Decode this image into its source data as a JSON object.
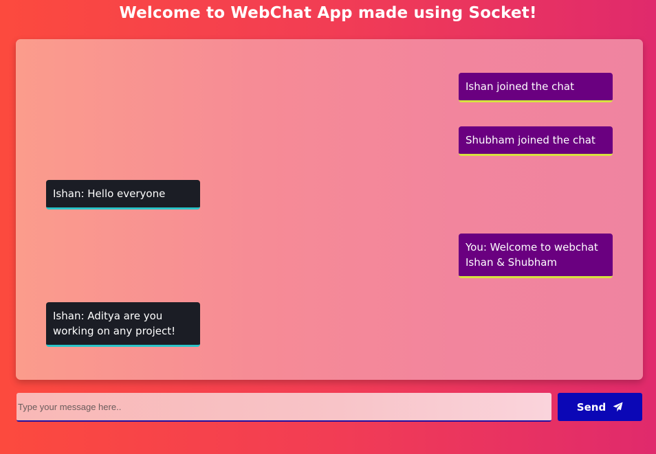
{
  "header": {
    "title": "Welcome to WebChat App made using Socket!"
  },
  "messages": [
    {
      "text": "Ishan joined the chat",
      "type": "outgoing"
    },
    {
      "text": "Shubham joined the chat",
      "type": "outgoing"
    },
    {
      "text": "Ishan: Hello everyone",
      "type": "incoming"
    },
    {
      "text": "You: Welcome to webchat Ishan & Shubham",
      "type": "outgoing"
    },
    {
      "text": "Ishan: Aditya are you working on any project!",
      "type": "incoming"
    }
  ],
  "composer": {
    "placeholder": "Type your message here..",
    "value": "",
    "send_label": "Send",
    "send_icon": "paper-plane-icon"
  },
  "colors": {
    "incoming_bg": "#1b1d25",
    "incoming_accent": "#2ac4c8",
    "outgoing_bg": "#6a0080",
    "outgoing_accent": "#d7e33e",
    "send_button": "#0b07b6"
  }
}
